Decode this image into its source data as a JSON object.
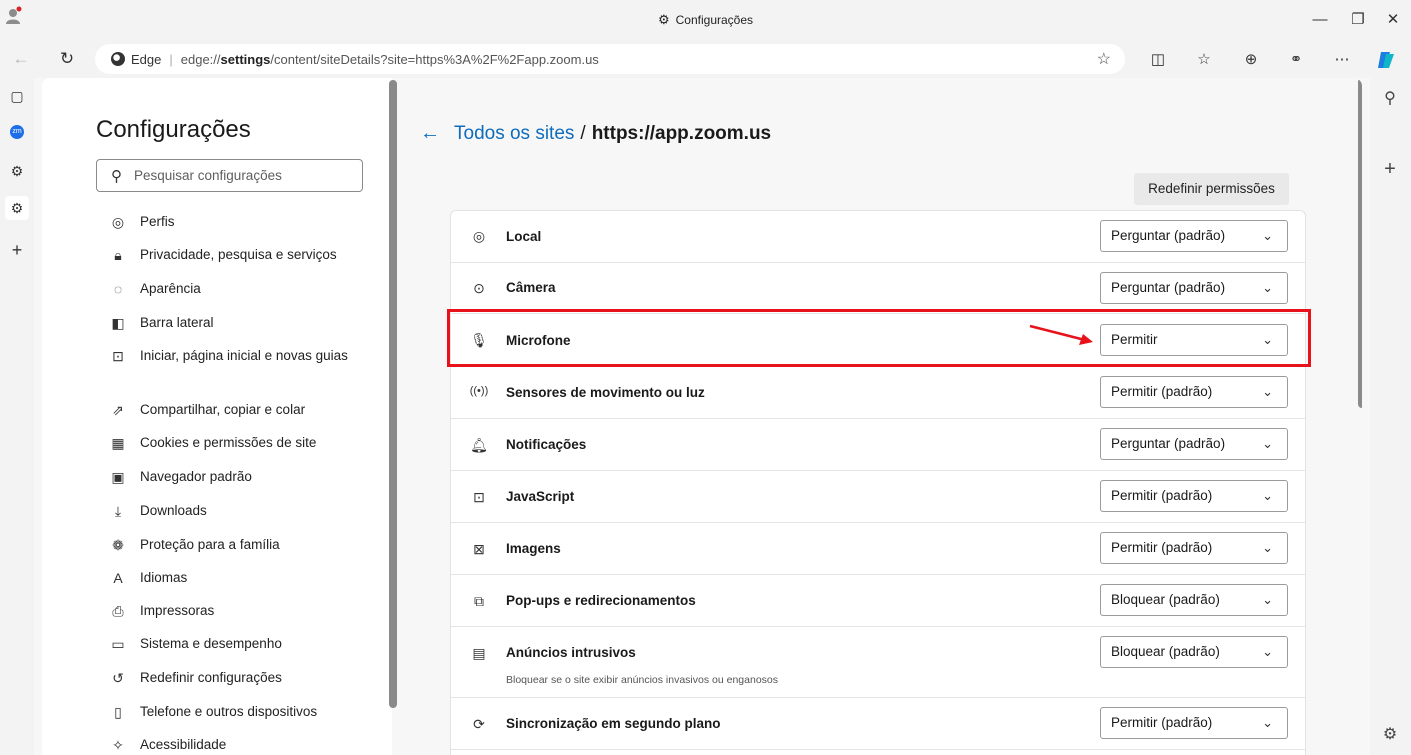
{
  "window": {
    "title": "Configurações"
  },
  "address": {
    "brand": "Edge",
    "url_prefix": "edge://",
    "url_bold": "settings",
    "url_rest": "/content/siteDetails?site=https%3A%2F%2Fapp.zoom.us"
  },
  "vertical_tabs": {
    "zoom_label": "zm"
  },
  "sidebar": {
    "title": "Configurações",
    "search_placeholder": "Pesquisar configurações",
    "items": [
      {
        "label": "Perfis",
        "icon": "profile-icon"
      },
      {
        "label": "Privacidade, pesquisa e serviços",
        "icon": "lock-icon"
      },
      {
        "label": "Aparência",
        "icon": "palette-icon"
      },
      {
        "label": "Barra lateral",
        "icon": "sidebar-icon"
      },
      {
        "label": "Iniciar, página inicial e novas guias",
        "icon": "home-tab-icon"
      },
      {
        "label": "Compartilhar, copiar e colar",
        "icon": "share-icon"
      },
      {
        "label": "Cookies e permissões de site",
        "icon": "cookie-icon"
      },
      {
        "label": "Navegador padrão",
        "icon": "browser-icon"
      },
      {
        "label": "Downloads",
        "icon": "download-icon"
      },
      {
        "label": "Proteção para a família",
        "icon": "family-icon"
      },
      {
        "label": "Idiomas",
        "icon": "language-icon"
      },
      {
        "label": "Impressoras",
        "icon": "printer-icon"
      },
      {
        "label": "Sistema e desempenho",
        "icon": "laptop-icon"
      },
      {
        "label": "Redefinir configurações",
        "icon": "reset-icon"
      },
      {
        "label": "Telefone e outros dispositivos",
        "icon": "phone-icon"
      },
      {
        "label": "Acessibilidade",
        "icon": "accessibility-icon"
      }
    ]
  },
  "main": {
    "crumb_link": "Todos os sites",
    "crumb_sep": "/",
    "crumb_site": "https://app.zoom.us",
    "reset_button": "Redefinir permissões",
    "permissions": [
      {
        "label": "Local",
        "value": "Perguntar (padrão)",
        "icon": "location-icon"
      },
      {
        "label": "Câmera",
        "value": "Perguntar (padrão)",
        "icon": "camera-icon"
      },
      {
        "label": "Microfone",
        "value": "Permitir",
        "icon": "microphone-icon",
        "highlighted": true
      },
      {
        "label": "Sensores de movimento ou luz",
        "value": "Permitir (padrão)",
        "icon": "sensor-icon"
      },
      {
        "label": "Notificações",
        "value": "Perguntar (padrão)",
        "icon": "bell-icon"
      },
      {
        "label": "JavaScript",
        "value": "Permitir (padrão)",
        "icon": "javascript-icon"
      },
      {
        "label": "Imagens",
        "value": "Permitir (padrão)",
        "icon": "image-icon"
      },
      {
        "label": "Pop-ups e redirecionamentos",
        "value": "Bloquear (padrão)",
        "icon": "popup-icon"
      },
      {
        "label": "Anúncios intrusivos",
        "value": "Bloquear (padrão)",
        "icon": "ads-icon",
        "description": "Bloquear se o site exibir anúncios invasivos ou enganosos"
      },
      {
        "label": "Sincronização em segundo plano",
        "value": "Permitir (padrão)",
        "icon": "sync-icon"
      }
    ]
  },
  "colors": {
    "accent": "#0f6cbd",
    "highlight": "#e8121b"
  }
}
